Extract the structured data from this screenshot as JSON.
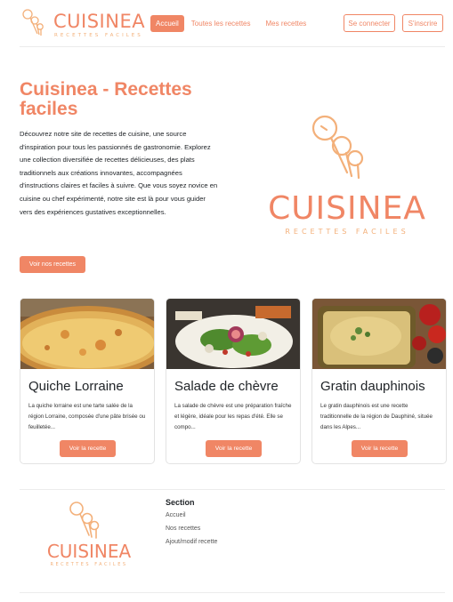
{
  "header": {
    "brand_name": "CUISINEA",
    "brand_tagline": "RECETTES FACILES",
    "nav": [
      {
        "label": "Accueil",
        "active": true
      },
      {
        "label": "Toutes les recettes",
        "active": false
      },
      {
        "label": "Mes recettes",
        "active": false
      }
    ],
    "login_label": "Se connecter",
    "signup_label": "S'inscrire"
  },
  "hero": {
    "title": "Cuisinea - Recettes faciles",
    "text": "Découvrez notre site de recettes de cuisine, une source d'inspiration pour tous les passionnés de gastronomie. Explorez une collection diversifiée de recettes délicieuses, des plats traditionnels aux créations innovantes, accompagnées d'instructions claires et faciles à suivre. Que vous soyez novice en cuisine ou chef expérimenté, notre site est là pour vous guider vers des expériences gustatives exceptionnelles.",
    "button_label": "Voir nos recettes",
    "logo_name": "CUISINEA",
    "logo_tagline": "RECETTES FACILES"
  },
  "recipes": [
    {
      "title": "Quiche Lorraine",
      "description": "La quiche lorraine est une tarte salée de la région Lorraine, composée d'une pâte brisée ou feuilletée...",
      "button_label": "Voir la recette"
    },
    {
      "title": "Salade de chèvre",
      "description": "La salade de chèvre est une préparation fraîche et légère, idéale pour les repas d'été. Elle se compo...",
      "button_label": "Voir la recette"
    },
    {
      "title": "Gratin dauphinois",
      "description": "Le gratin dauphinois est une recette traditionnelle de la région de Dauphiné, située dans les Alpes...",
      "button_label": "Voir la recette"
    }
  ],
  "footer": {
    "logo_name": "CUISINEA",
    "logo_tagline": "RECETTES FACILES",
    "section_title": "Section",
    "links": [
      "Accueil",
      "Nos recettes",
      "Ajout/modif recette"
    ]
  },
  "colors": {
    "accent": "#f08665",
    "accent_light": "#f3b07a"
  }
}
